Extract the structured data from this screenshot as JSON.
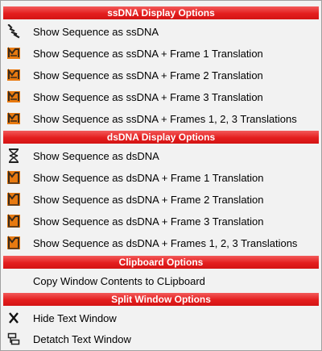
{
  "menu": {
    "ssdna_header": "ssDNA Display Options",
    "ssdna_items": [
      {
        "label": "Show Sequence as ssDNA",
        "icon": "ssdna-strand-icon"
      },
      {
        "label": "Show Sequence as ssDNA + Frame 1 Translation",
        "icon": "ssdna-translation-icon"
      },
      {
        "label": "Show Sequence as ssDNA + Frame 2 Translation",
        "icon": "ssdna-translation-icon"
      },
      {
        "label": "Show Sequence as ssDNA + Frame 3 Translation",
        "icon": "ssdna-translation-icon"
      },
      {
        "label": "Show Sequence as ssDNA + Frames 1, 2, 3 Translations",
        "icon": "ssdna-translation-icon"
      }
    ],
    "dsdna_header": "dsDNA Display Options",
    "dsdna_items": [
      {
        "label": "Show Sequence as dsDNA",
        "icon": "dsdna-helix-icon"
      },
      {
        "label": "Show Sequence as dsDNA + Frame 1 Translation",
        "icon": "dsdna-translation-icon"
      },
      {
        "label": "Show Sequence as dsDNA + Frame 2 Translation",
        "icon": "dsdna-translation-icon"
      },
      {
        "label": "Show Sequence as dsDNA + Frame 3 Translation",
        "icon": "dsdna-translation-icon"
      },
      {
        "label": "Show Sequence as dsDNA + Frames 1, 2, 3 Translations",
        "icon": "dsdna-translation-icon"
      }
    ],
    "clipboard_header": "Clipboard Options",
    "clipboard_items": [
      {
        "label": "Copy Window Contents to CLipboard"
      }
    ],
    "split_header": "Split Window Options",
    "split_items": [
      {
        "label": "Hide Text Window",
        "icon": "x-icon"
      },
      {
        "label": "Detatch Text Window",
        "icon": "detach-window-icon"
      }
    ]
  },
  "colors": {
    "header_red": "#e41e1e",
    "icon_orange": "#e87a10",
    "icon_dark": "#3a2a1a"
  }
}
